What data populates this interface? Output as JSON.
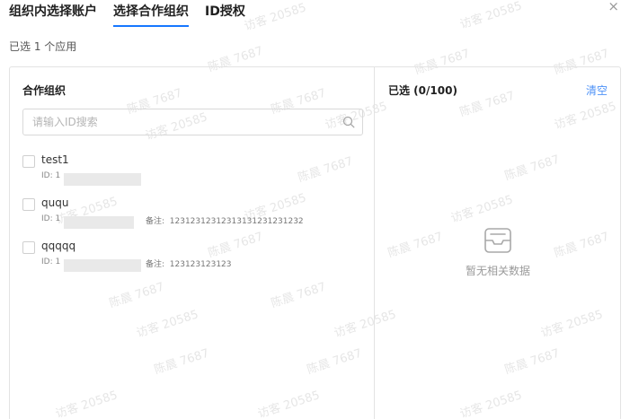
{
  "tabs": [
    "组织内选择账户",
    "选择合作组织",
    "ID授权"
  ],
  "close_label": "×",
  "selected_summary": "已选 1 个应用",
  "left_panel": {
    "title": "合作组织",
    "search_placeholder": "请输入ID搜索",
    "items": [
      {
        "name": "test1",
        "id_label": "ID: 1",
        "remark_label": "",
        "remark_value": ""
      },
      {
        "name": "ququ",
        "id_label": "ID: 1",
        "remark_label": "备注:",
        "remark_value": "12312312312313131231231232"
      },
      {
        "name": "qqqqq",
        "id_label": "ID: 1",
        "remark_label": "备注:",
        "remark_value": "123123123123"
      }
    ]
  },
  "right_panel": {
    "title": "已选 (0/100)",
    "clear_label": "清空",
    "empty_text": "暂无相关数据"
  },
  "watermark_texts": [
    "访客 20585",
    "陈晨 7687"
  ],
  "colors": {
    "accent": "#1677ff",
    "link": "#4e92f7",
    "border": "#e3e3e3"
  }
}
